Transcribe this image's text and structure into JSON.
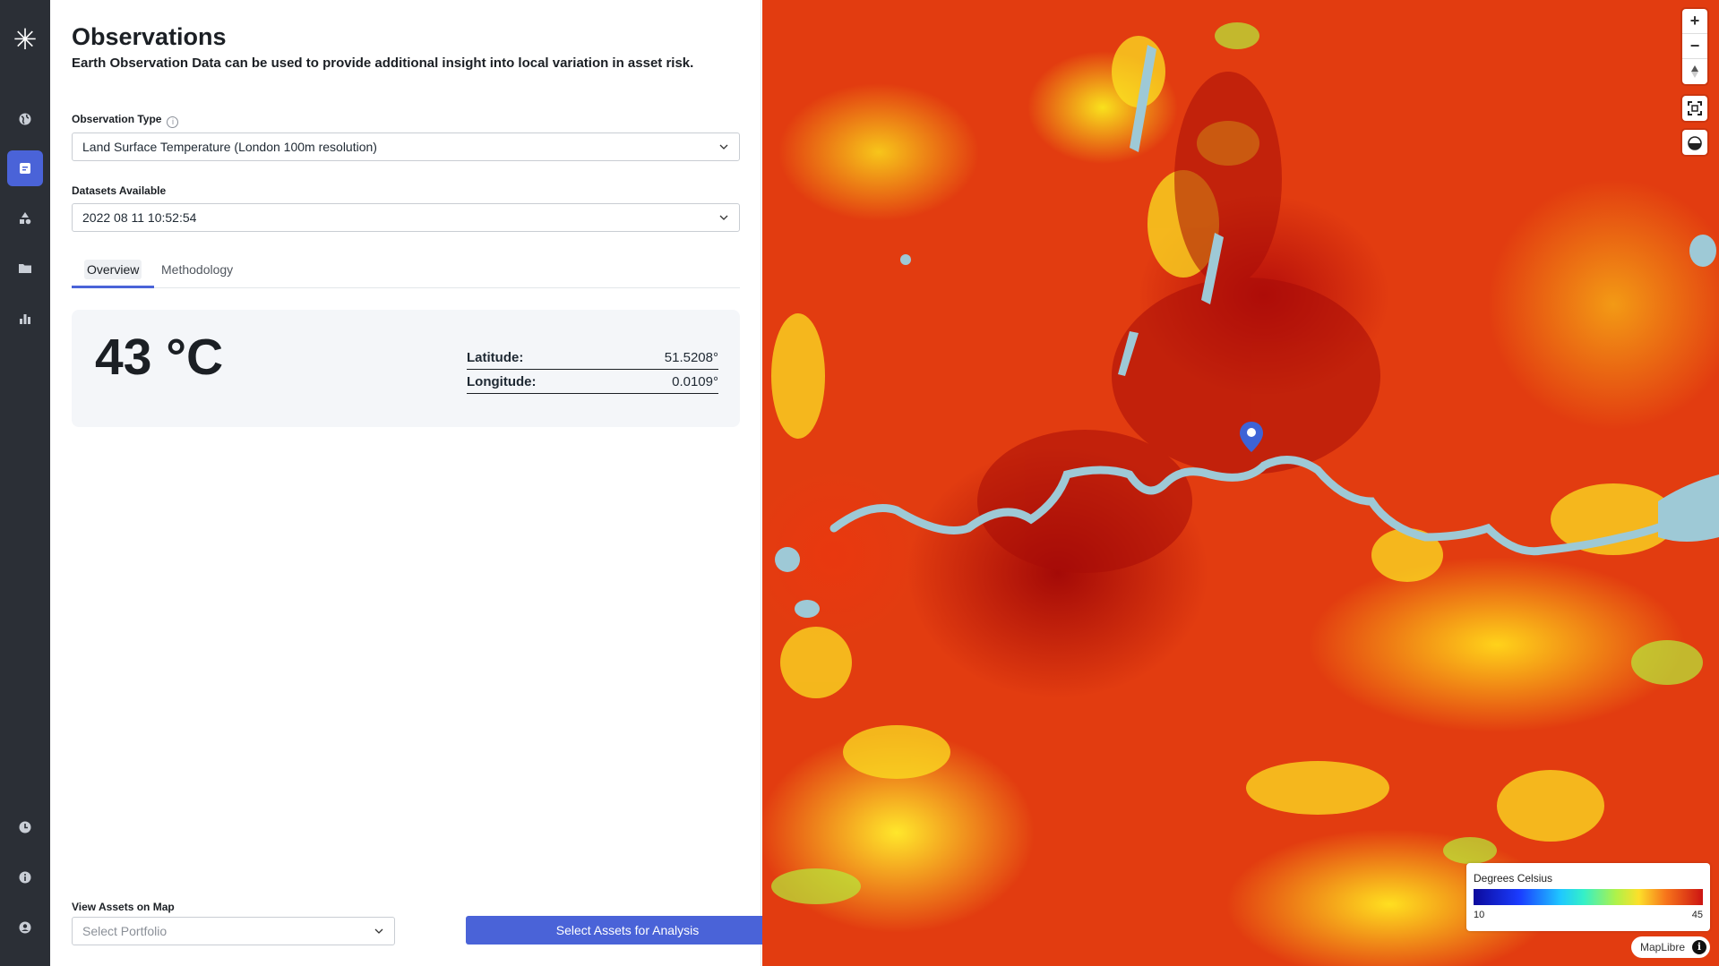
{
  "header": {
    "title": "Observations",
    "subtitle": "Earth Observation Data can be used to provide additional insight into local variation in asset risk."
  },
  "observation_type": {
    "label": "Observation Type",
    "value": "Land Surface Temperature (London 100m resolution)"
  },
  "datasets": {
    "label": "Datasets Available",
    "value": "2022 08 11 10:52:54"
  },
  "tabs": [
    {
      "label": "Overview",
      "active": true
    },
    {
      "label": "Methodology",
      "active": false
    }
  ],
  "reading": {
    "temperature": "43 °C",
    "latitude_label": "Latitude:",
    "latitude_value": "51.5208°",
    "longitude_label": "Longitude:",
    "longitude_value": "0.0109°"
  },
  "assets": {
    "label": "View Assets on Map",
    "portfolio_placeholder": "Select Portfolio",
    "analysis_button": "Select Assets for Analysis"
  },
  "map": {
    "zoom_in": "+",
    "zoom_out": "−",
    "legend_title": "Degrees Celsius",
    "legend_min": "10",
    "legend_max": "45",
    "attribution": "MapLibre",
    "info": "i"
  },
  "sidebar_icons": [
    "logo-icon",
    "globe-icon",
    "observations-icon",
    "shapes-icon",
    "folder-icon",
    "bar-chart-icon",
    "clock-icon",
    "info-icon",
    "user-icon"
  ],
  "colors": {
    "accent": "#4a63d8",
    "rail": "#2b2f36",
    "heat_hot": "#b60e0a",
    "heat_warm": "#f9e11d",
    "water": "#9ec9d6"
  }
}
